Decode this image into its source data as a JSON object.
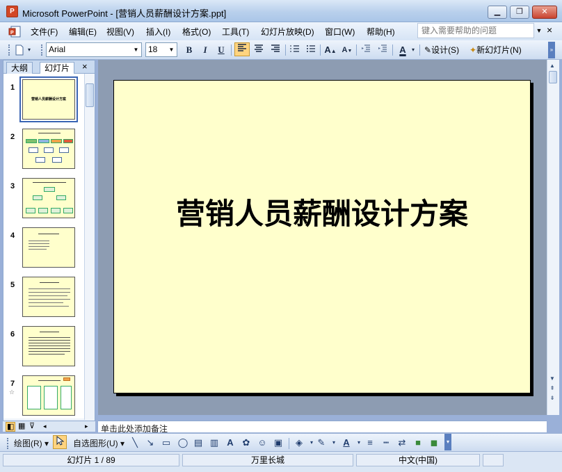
{
  "window": {
    "title": "Microsoft PowerPoint - [营销人员薪酬设计方案.ppt]",
    "app_icon_label": "P",
    "minimize_glyph": "▁",
    "restore_glyph": "❐",
    "close_glyph": "✕"
  },
  "menu": {
    "items": [
      "文件(F)",
      "编辑(E)",
      "视图(V)",
      "插入(I)",
      "格式(O)",
      "工具(T)",
      "幻灯片放映(D)",
      "窗口(W)",
      "帮助(H)"
    ],
    "help_placeholder": "键入需要帮助的问题",
    "mdi_close_glyph": "×"
  },
  "format_toolbar": {
    "font_name": "Arial",
    "font_size": "18",
    "bold": "B",
    "italic": "I",
    "underline": "U",
    "font_color_label": "A",
    "design_label": "设计(S)",
    "new_slide_label": "新幻灯片(N)",
    "active_button": "align-left"
  },
  "left_pane": {
    "tabs": [
      "大纲",
      "幻灯片"
    ],
    "active_tab": "幻灯片",
    "close_glyph": "×",
    "slides": [
      {
        "number": "1",
        "title": "营销人员薪酬设计方案",
        "selected": true
      },
      {
        "number": "2",
        "title": "",
        "selected": false
      },
      {
        "number": "3",
        "title": "",
        "selected": false
      },
      {
        "number": "4",
        "title": "",
        "selected": false
      },
      {
        "number": "5",
        "title": "",
        "selected": false
      },
      {
        "number": "6",
        "title": "",
        "selected": false
      },
      {
        "number": "7",
        "title": "",
        "selected": false,
        "has_animation": true
      }
    ]
  },
  "slide": {
    "title": "营销人员薪酬设计方案",
    "background": "#ffffcc"
  },
  "notes": {
    "placeholder": "单击此处添加备注"
  },
  "draw_toolbar": {
    "draw_label": "绘图(R)",
    "autoshapes_label": "自选图形(U)",
    "font_color_label": "A"
  },
  "status": {
    "slide_position": "幻灯片 1 / 89",
    "design_template": "万里长城",
    "language": "中文(中国)"
  },
  "colors": {
    "accent": "#ffd480",
    "slide_bg": "#ffffcc",
    "title_bar": "#b9d0ec"
  }
}
